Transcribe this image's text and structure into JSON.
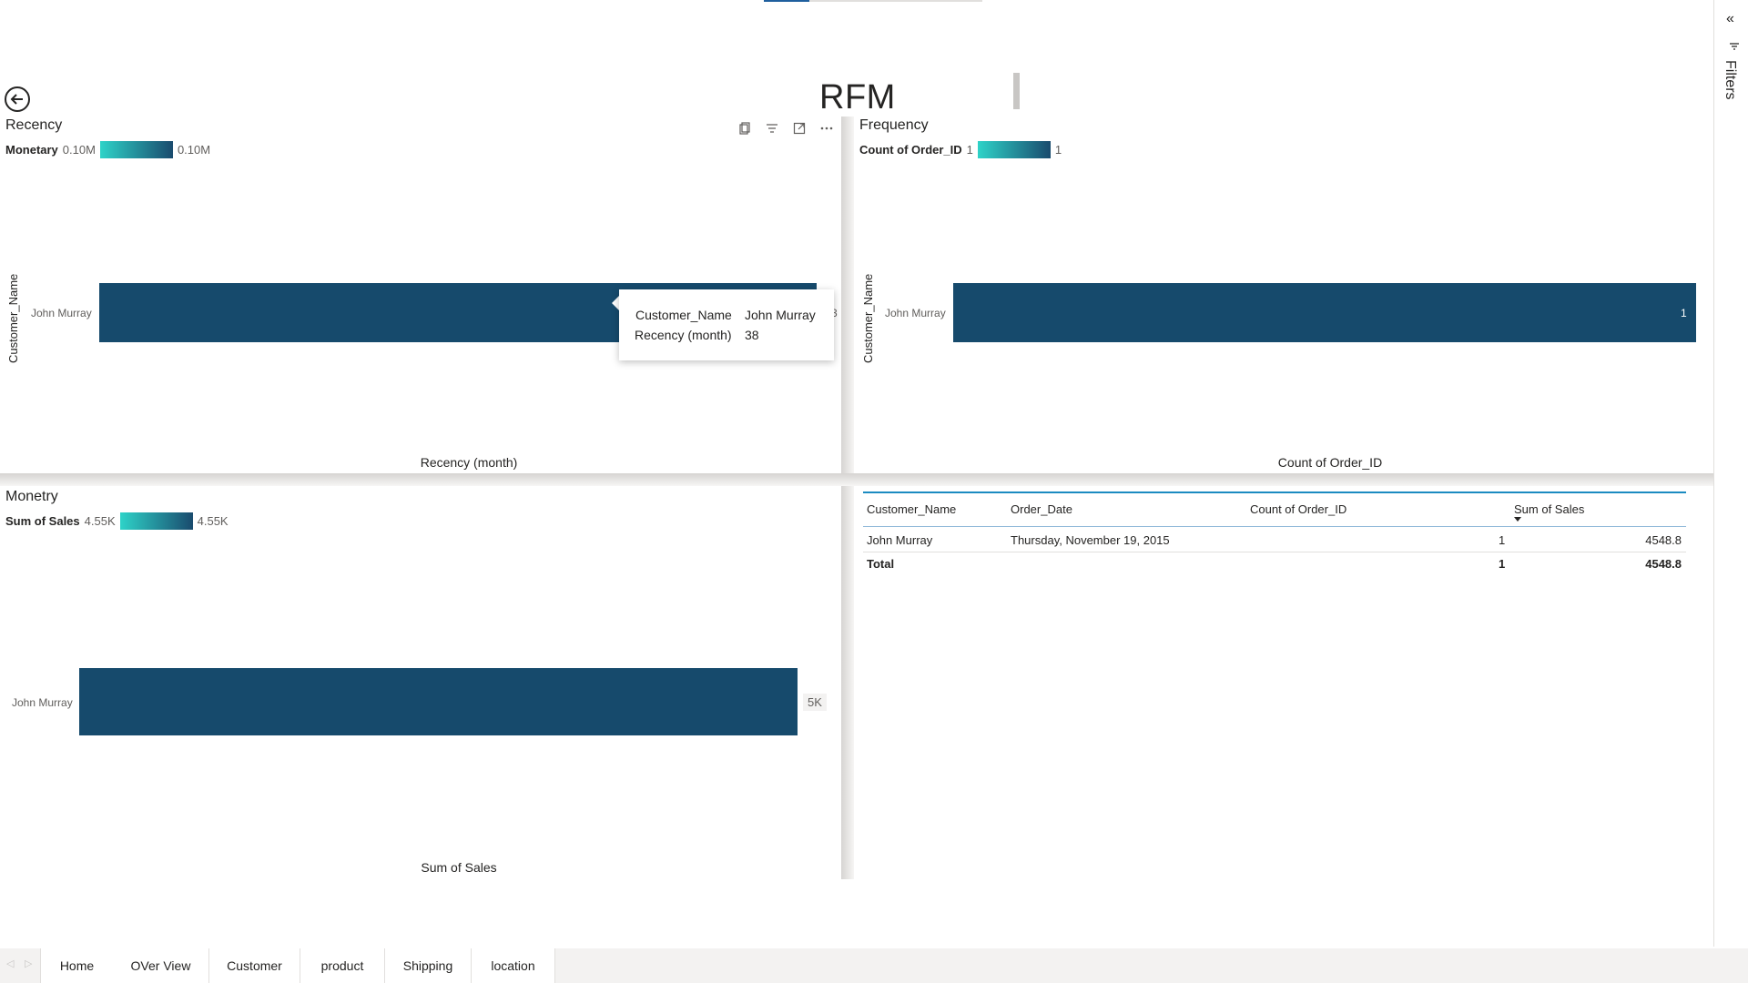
{
  "page": {
    "title": "RFM"
  },
  "recency": {
    "title": "Recency",
    "legend_title": "Monetary",
    "legend_min": "0.10M",
    "legend_max": "0.10M",
    "y_axis_label": "Customer_Name",
    "x_axis_label": "Recency (month)",
    "category": "John Murray",
    "data_label": "3"
  },
  "tooltip": {
    "key1": "Customer_Name",
    "val1": "John Murray",
    "key2": "Recency (month)",
    "val2": "38"
  },
  "frequency": {
    "title": "Frequency",
    "legend_title": "Count of Order_ID",
    "legend_min": "1",
    "legend_max": "1",
    "y_axis_label": "Customer_Name",
    "x_axis_label": "Count of Order_ID",
    "category": "John Murray",
    "data_label": "1"
  },
  "monetary": {
    "title": "Monetry",
    "legend_title": "Sum of Sales",
    "legend_min": "4.55K",
    "legend_max": "4.55K",
    "x_axis_label": "Sum of Sales",
    "category": "John Murray",
    "data_label": "5K"
  },
  "table": {
    "headers": [
      "Customer_Name",
      "Order_Date",
      "Count of Order_ID",
      "Sum of Sales"
    ],
    "rows": [
      [
        "John Murray",
        "Thursday, November 19, 2015",
        "1",
        "4548.8"
      ]
    ],
    "total": {
      "label": "Total",
      "count": "1",
      "sales": "4548.8"
    }
  },
  "filters": {
    "label": "Filters"
  },
  "tabs": [
    "Home",
    "OVer View",
    "Customer",
    "product",
    "Shipping",
    "location"
  ],
  "colors": {
    "bar": "#164a6c",
    "gradient_start": "#2ed3c8",
    "gradient_end": "#1a4b6e",
    "table_accent": "#1b8bc1"
  },
  "chart_data": [
    {
      "type": "bar",
      "title": "Recency",
      "categories": [
        "John Murray"
      ],
      "values": [
        38
      ],
      "xlabel": "Recency (month)",
      "ylabel": "Customer_Name"
    },
    {
      "type": "bar",
      "title": "Frequency",
      "categories": [
        "John Murray"
      ],
      "values": [
        1
      ],
      "xlabel": "Count of Order_ID",
      "ylabel": "Customer_Name"
    },
    {
      "type": "bar",
      "title": "Monetry",
      "categories": [
        "John Murray"
      ],
      "values": [
        4548.8
      ],
      "xlabel": "Sum of Sales",
      "ylabel": ""
    }
  ]
}
